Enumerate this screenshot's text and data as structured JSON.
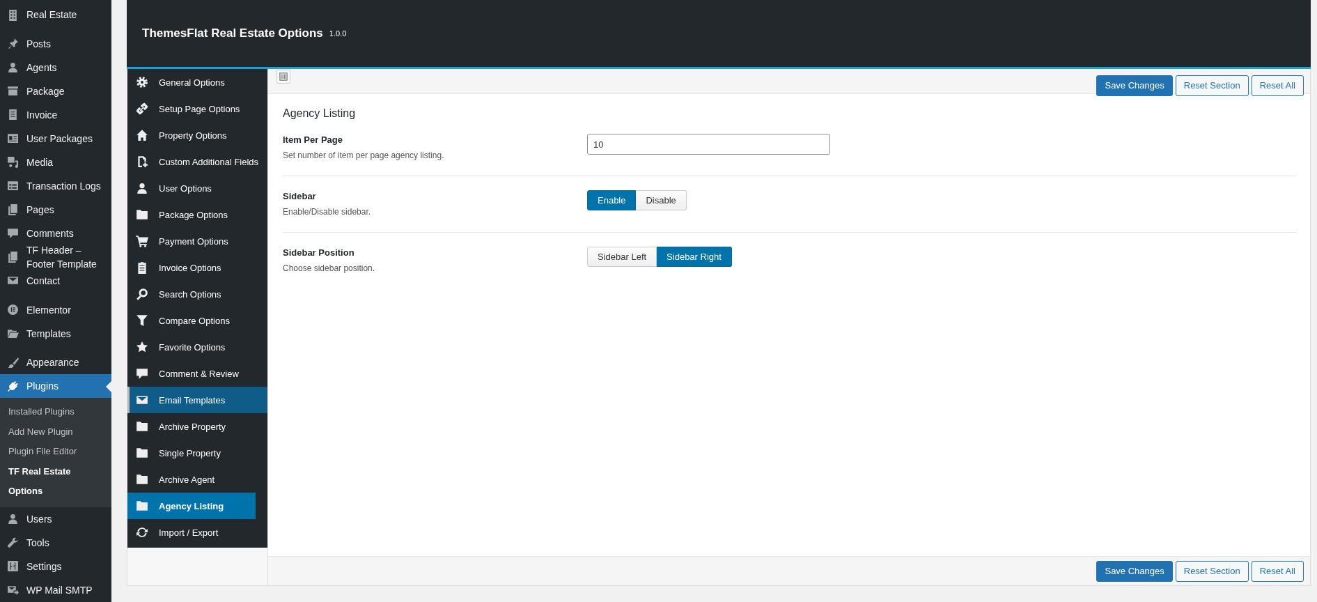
{
  "admin_menu": [
    {
      "label": "Real Estate",
      "selected": false
    },
    {
      "label": "Posts",
      "selected": false
    },
    {
      "label": "Agents",
      "selected": false
    },
    {
      "label": "Package",
      "selected": false
    },
    {
      "label": "Invoice",
      "selected": false
    },
    {
      "label": "User Packages",
      "selected": false
    },
    {
      "label": "Media",
      "selected": false
    },
    {
      "label": "Transaction Logs",
      "selected": false
    },
    {
      "label": "Pages",
      "selected": false
    },
    {
      "label": "Comments",
      "selected": false
    },
    {
      "label": "TF Header – Footer Template",
      "selected": false
    },
    {
      "label": "Contact",
      "selected": false
    },
    {
      "label": "Elementor",
      "selected": false
    },
    {
      "label": "Templates",
      "selected": false
    },
    {
      "label": "Appearance",
      "selected": false
    },
    {
      "label": "Plugins",
      "selected": true,
      "submenu": [
        {
          "label": "Installed Plugins",
          "selected": false
        },
        {
          "label": "Add New Plugin",
          "selected": false
        },
        {
          "label": "Plugin File Editor",
          "selected": false
        },
        {
          "label": "TF Real Estate Options",
          "selected": true
        }
      ]
    },
    {
      "label": "Users",
      "selected": false
    },
    {
      "label": "Tools",
      "selected": false
    },
    {
      "label": "Settings",
      "selected": false
    },
    {
      "label": "WP Mail SMTP",
      "selected": false
    }
  ],
  "header": {
    "title": "ThemesFlat Real Estate Options",
    "version": "1.0.0"
  },
  "options_menu": [
    {
      "label": "General Options",
      "selected": false,
      "hovered": false
    },
    {
      "label": "Setup Page Options",
      "selected": false,
      "hovered": false
    },
    {
      "label": "Property Options",
      "selected": false,
      "hovered": false
    },
    {
      "label": "Custom Additional Fields",
      "selected": false,
      "hovered": false
    },
    {
      "label": "User Options",
      "selected": false,
      "hovered": false
    },
    {
      "label": "Package Options",
      "selected": false,
      "hovered": false
    },
    {
      "label": "Payment Options",
      "selected": false,
      "hovered": false
    },
    {
      "label": "Invoice Options",
      "selected": false,
      "hovered": false
    },
    {
      "label": "Search Options",
      "selected": false,
      "hovered": false
    },
    {
      "label": "Compare Options",
      "selected": false,
      "hovered": false
    },
    {
      "label": "Favorite Options",
      "selected": false,
      "hovered": false
    },
    {
      "label": "Comment & Review",
      "selected": false,
      "hovered": false
    },
    {
      "label": "Email Templates",
      "selected": false,
      "hovered": true
    },
    {
      "label": "Archive Property",
      "selected": false,
      "hovered": false
    },
    {
      "label": "Single Property",
      "selected": false,
      "hovered": false
    },
    {
      "label": "Archive Agent",
      "selected": false,
      "hovered": false
    },
    {
      "label": "Agency Listing",
      "selected": true,
      "hovered": false
    },
    {
      "label": "Import / Export",
      "selected": false,
      "hovered": false
    }
  ],
  "top_actions": [
    "Save Changes",
    "Reset Section",
    "Reset All"
  ],
  "section": {
    "title": "Agency Listing",
    "fields": [
      {
        "kind": "text",
        "label": "Item Per Page",
        "description": "Set number of item per page agency listing.",
        "value": "10"
      },
      {
        "kind": "button_set",
        "label": "Sidebar",
        "description": "Enable/Disable sidebar.",
        "options": [
          {
            "label": "Enable",
            "selected": true
          },
          {
            "label": "Disable",
            "selected": false
          }
        ]
      },
      {
        "kind": "button_set",
        "label": "Sidebar Position",
        "description": "Choose sidebar position.",
        "options": [
          {
            "label": "Sidebar Left",
            "selected": false
          },
          {
            "label": "Sidebar Right",
            "selected": true
          }
        ]
      }
    ]
  },
  "bottom_actions": [
    "Save Changes",
    "Reset Section",
    "Reset All"
  ]
}
